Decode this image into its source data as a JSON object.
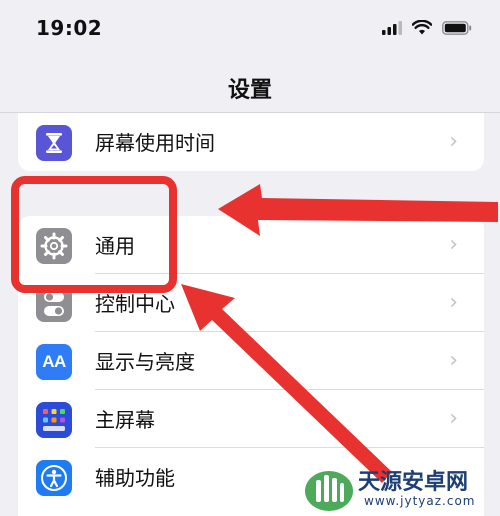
{
  "status_bar": {
    "time": "19:02",
    "icons": [
      "cellular-signal-icon",
      "wifi-icon",
      "battery-icon"
    ]
  },
  "nav": {
    "title": "设置"
  },
  "settings": {
    "top_group": [
      {
        "label": "屏幕使用时间",
        "icon": "hourglass-icon",
        "icon_color": "#5856d6"
      }
    ],
    "main_group": [
      {
        "label": "通用",
        "icon": "gear-icon",
        "icon_color": "#8e8e93"
      },
      {
        "label": "控制中心",
        "icon": "toggles-icon",
        "icon_color": "#8e8e93"
      },
      {
        "label": "显示与亮度",
        "icon": "text-size-icon",
        "icon_color": "#2f7cf6"
      },
      {
        "label": "主屏幕",
        "icon": "home-grid-icon",
        "icon_color": "#2c4bd6"
      },
      {
        "label": "辅助功能",
        "icon": "accessibility-icon",
        "icon_color": "#1e7bf2"
      }
    ],
    "icon_text": {
      "display": "AA"
    }
  },
  "annotation": {
    "color": "#e8322f"
  },
  "watermark": {
    "text": "天源安卓网",
    "url": "www.jytyaz.com"
  }
}
